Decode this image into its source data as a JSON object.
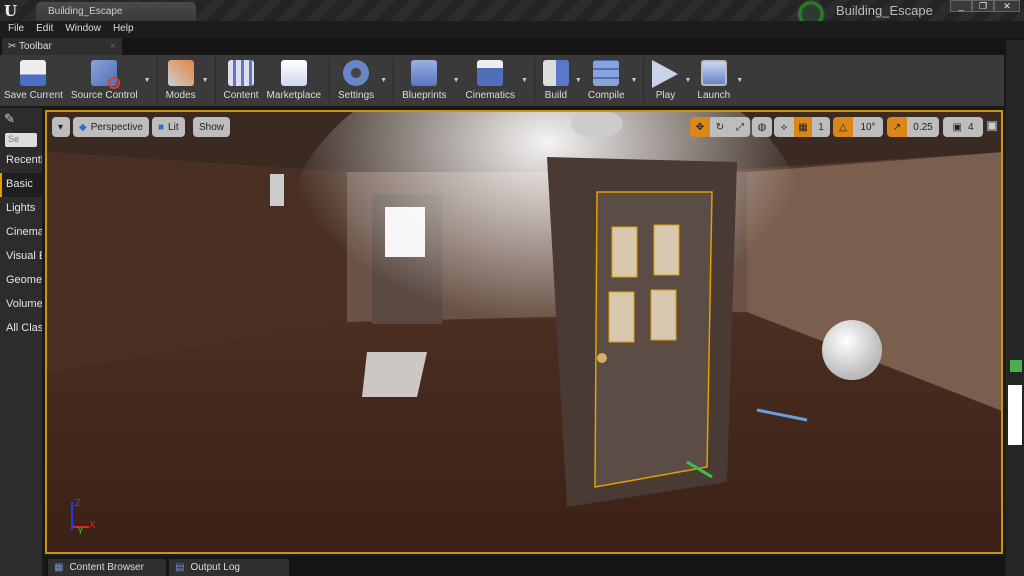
{
  "title_bar": {
    "tab_title": "Building_Escape",
    "project_name": "Building_Escape",
    "minimize": "_",
    "restore": "❐",
    "close": "✕"
  },
  "menu": [
    "File",
    "Edit",
    "Window",
    "Help"
  ],
  "toolbar_tab": {
    "label": "Toolbar",
    "close": "×"
  },
  "toolbar": {
    "save": "Save Current",
    "source_control": "Source Control",
    "modes": "Modes",
    "content": "Content",
    "marketplace": "Marketplace",
    "settings": "Settings",
    "blueprints": "Blueprints",
    "cinematics": "Cinematics",
    "build": "Build",
    "compile": "Compile",
    "play": "Play",
    "launch": "Launch"
  },
  "modes_panel": {
    "search_placeholder": "Se",
    "categories": [
      "Recently Placed",
      "Basic",
      "Lights",
      "Cinematic",
      "Visual Effects",
      "Geometry",
      "Volumes",
      "All Classes"
    ],
    "selected": "Basic"
  },
  "viewport": {
    "perspective": "Perspective",
    "lit": "Lit",
    "show": "Show",
    "grid_snap": "1",
    "rotation_snap": "10°",
    "scale_snap": "0.25",
    "camera_speed": "4",
    "axis": {
      "x": "X",
      "y": "Y",
      "z": "Z"
    }
  },
  "bottom_tabs": [
    "Content Browser",
    "Output Log"
  ],
  "colors": {
    "accent": "#d9871a",
    "selection": "#c8960a"
  }
}
